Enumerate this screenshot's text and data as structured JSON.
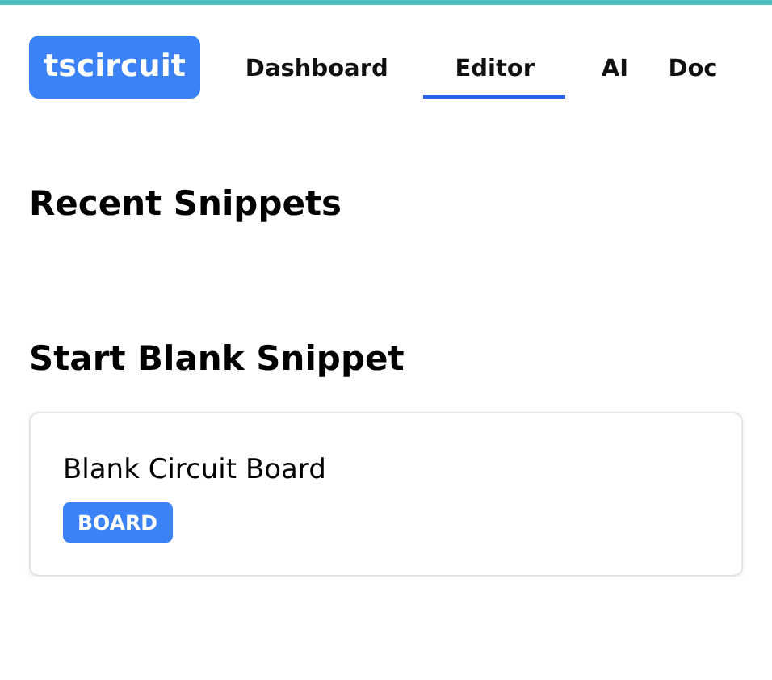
{
  "header": {
    "logo": "tscircuit",
    "nav": [
      {
        "label": "Dashboard",
        "selected": false
      },
      {
        "label": "Editor",
        "selected": true
      },
      {
        "label": "AI",
        "selected": false
      },
      {
        "label": "Doc",
        "selected": false
      }
    ]
  },
  "recent_snippets": {
    "title": "Recent Snippets"
  },
  "start_blank": {
    "title": "Start Blank Snippet",
    "cards": [
      {
        "name": "Blank Circuit Board",
        "tag": "BOARD"
      }
    ]
  }
}
